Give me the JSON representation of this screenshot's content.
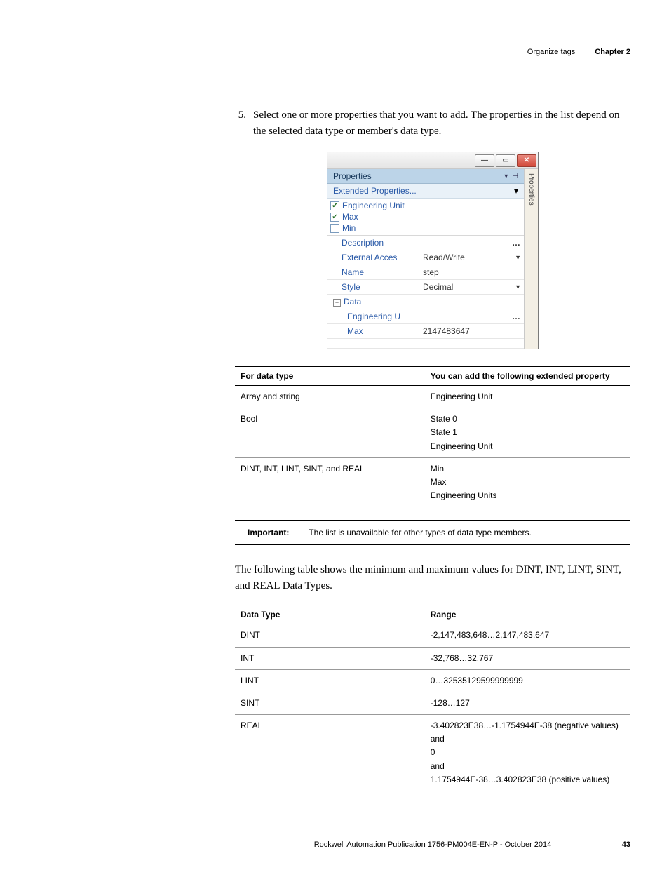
{
  "header": {
    "section": "Organize tags",
    "chapter": "Chapter 2"
  },
  "step": {
    "num": "5.",
    "text": "Select one or more properties that you want to add. The properties in the list depend on the selected data type or member's data type."
  },
  "props_panel": {
    "section_title": "Properties",
    "ext_link": "Extended Properties...",
    "vert_tab": "Properties",
    "checks": [
      {
        "label": "Engineering Unit",
        "checked": true
      },
      {
        "label": "Max",
        "checked": true
      },
      {
        "label": "Min",
        "checked": false
      }
    ],
    "rows": [
      {
        "name": "Description",
        "value": "",
        "control": "dots"
      },
      {
        "name": "External Acces",
        "value": "Read/Write",
        "control": "dd"
      },
      {
        "name": "Name",
        "value": "step",
        "control": ""
      },
      {
        "name": "Style",
        "value": "Decimal",
        "control": "dd"
      }
    ],
    "group_label": "Data",
    "group_rows": [
      {
        "name": "Engineering U",
        "value": "",
        "control": "dots"
      },
      {
        "name": "Max",
        "value": "2147483647",
        "control": ""
      }
    ]
  },
  "table1": {
    "headers": [
      "For data type",
      "You can add the following extended property"
    ],
    "rows": [
      {
        "c0": "Array and string",
        "c1": "Engineering Unit"
      },
      {
        "c0": "Bool",
        "c1": "State 0\nState 1\nEngineering Unit"
      },
      {
        "c0": "DINT, INT, LINT, SINT, and REAL",
        "c1": "Min\nMax\nEngineering Units"
      }
    ]
  },
  "note": {
    "label": "Important:",
    "text": "The list is unavailable for other types of data type members."
  },
  "para": "The following table shows the minimum and maximum values for DINT, INT, LINT, SINT, and REAL Data Types.",
  "table2": {
    "headers": [
      "Data Type",
      "Range"
    ],
    "rows": [
      {
        "c0": "DINT",
        "c1": "-2,147,483,648…2,147,483,647"
      },
      {
        "c0": "INT",
        "c1": "-32,768…32,767"
      },
      {
        "c0": "LINT",
        "c1": "0…32535129599999999"
      },
      {
        "c0": "SINT",
        "c1": "-128…127"
      },
      {
        "c0": "REAL",
        "c1": "-3.402823E38…-1.1754944E-38   (negative values)\nand\n0\nand\n1.1754944E-38…3.402823E38   (positive values)"
      }
    ]
  },
  "footer": {
    "pub": "Rockwell Automation Publication 1756-PM004E-EN-P - October 2014",
    "page": "43"
  }
}
